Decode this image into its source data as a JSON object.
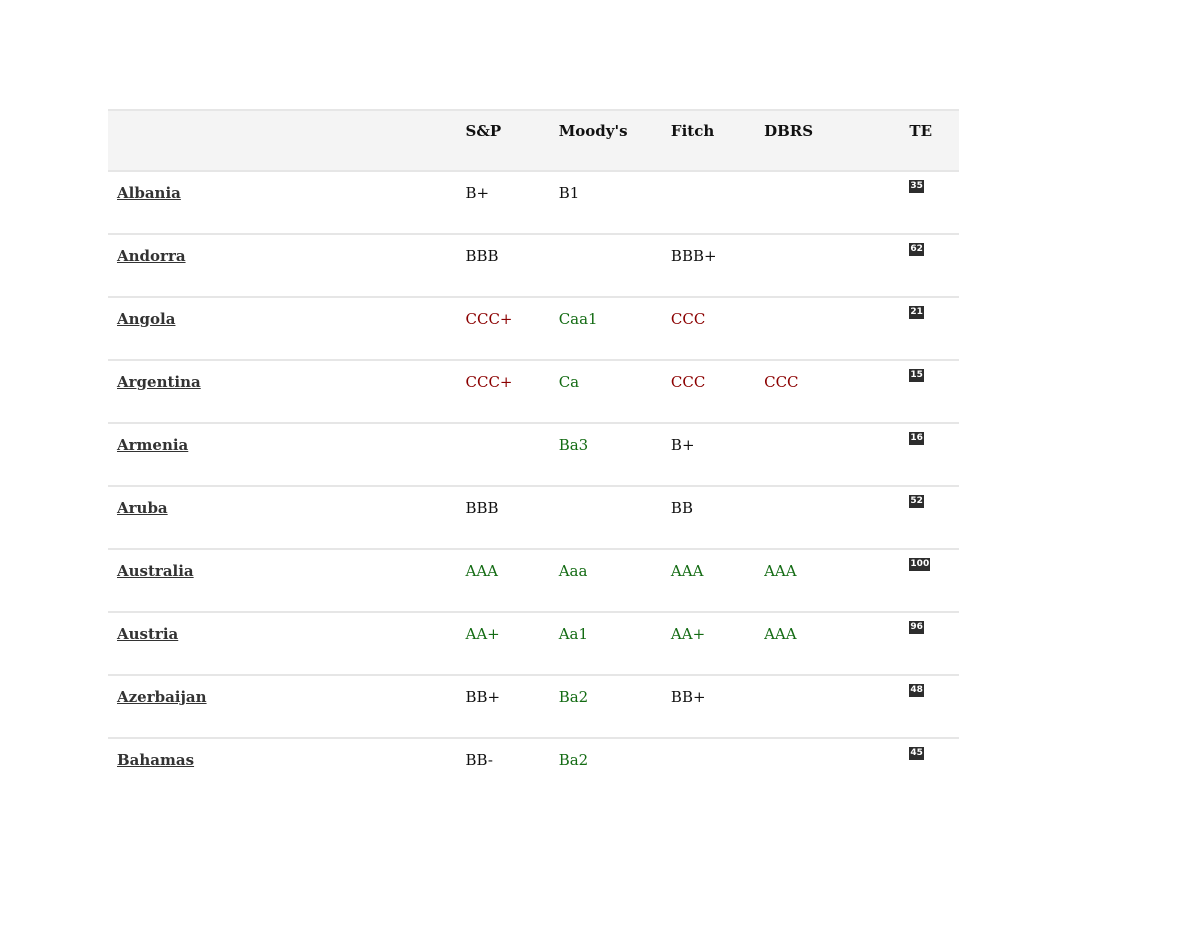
{
  "columns": {
    "country": "",
    "sp": "S&P",
    "moodys": "Moody's",
    "fitch": "Fitch",
    "dbrs": "DBRS",
    "te": "TE"
  },
  "colors": {
    "green": "#136b13",
    "red": "#8b0000",
    "neutral": "#111111",
    "header_bg": "#f4f4f4",
    "badge_bg": "#2d2d2d"
  },
  "rows": [
    {
      "country": "Albania",
      "sp": {
        "v": "B+",
        "c": "neutral"
      },
      "moodys": {
        "v": "B1",
        "c": "neutral"
      },
      "fitch": {
        "v": "",
        "c": "neutral"
      },
      "dbrs": {
        "v": "",
        "c": "neutral"
      },
      "te": "35"
    },
    {
      "country": "Andorra",
      "sp": {
        "v": "BBB",
        "c": "neutral"
      },
      "moodys": {
        "v": "",
        "c": "neutral"
      },
      "fitch": {
        "v": "BBB+",
        "c": "neutral"
      },
      "dbrs": {
        "v": "",
        "c": "neutral"
      },
      "te": "62"
    },
    {
      "country": "Angola",
      "sp": {
        "v": "CCC+",
        "c": "red"
      },
      "moodys": {
        "v": "Caa1",
        "c": "green"
      },
      "fitch": {
        "v": "CCC",
        "c": "red"
      },
      "dbrs": {
        "v": "",
        "c": "neutral"
      },
      "te": "21"
    },
    {
      "country": "Argentina",
      "sp": {
        "v": "CCC+",
        "c": "red"
      },
      "moodys": {
        "v": "Ca",
        "c": "green"
      },
      "fitch": {
        "v": "CCC",
        "c": "red"
      },
      "dbrs": {
        "v": "CCC",
        "c": "red"
      },
      "te": "15"
    },
    {
      "country": "Armenia",
      "sp": {
        "v": "",
        "c": "neutral"
      },
      "moodys": {
        "v": "Ba3",
        "c": "green"
      },
      "fitch": {
        "v": "B+",
        "c": "neutral"
      },
      "dbrs": {
        "v": "",
        "c": "neutral"
      },
      "te": "16"
    },
    {
      "country": "Aruba",
      "sp": {
        "v": "BBB",
        "c": "neutral"
      },
      "moodys": {
        "v": "",
        "c": "neutral"
      },
      "fitch": {
        "v": "BB",
        "c": "neutral"
      },
      "dbrs": {
        "v": "",
        "c": "neutral"
      },
      "te": "52"
    },
    {
      "country": "Australia",
      "sp": {
        "v": "AAA",
        "c": "green"
      },
      "moodys": {
        "v": "Aaa",
        "c": "green"
      },
      "fitch": {
        "v": "AAA",
        "c": "green"
      },
      "dbrs": {
        "v": "AAA",
        "c": "green"
      },
      "te": "100"
    },
    {
      "country": "Austria",
      "sp": {
        "v": "AA+",
        "c": "green"
      },
      "moodys": {
        "v": "Aa1",
        "c": "green"
      },
      "fitch": {
        "v": "AA+",
        "c": "green"
      },
      "dbrs": {
        "v": "AAA",
        "c": "green"
      },
      "te": "96"
    },
    {
      "country": "Azerbaijan",
      "sp": {
        "v": "BB+",
        "c": "neutral"
      },
      "moodys": {
        "v": "Ba2",
        "c": "green"
      },
      "fitch": {
        "v": "BB+",
        "c": "neutral"
      },
      "dbrs": {
        "v": "",
        "c": "neutral"
      },
      "te": "48"
    },
    {
      "country": "Bahamas",
      "sp": {
        "v": "BB-",
        "c": "neutral"
      },
      "moodys": {
        "v": "Ba2",
        "c": "green"
      },
      "fitch": {
        "v": "",
        "c": "neutral"
      },
      "dbrs": {
        "v": "",
        "c": "neutral"
      },
      "te": "45"
    }
  ]
}
